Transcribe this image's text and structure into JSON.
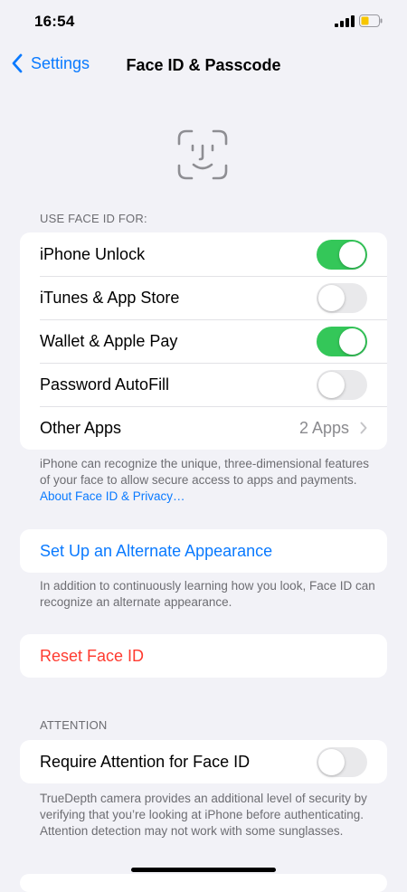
{
  "status_bar": {
    "time": "16:54",
    "battery_color": "#f7c600"
  },
  "nav": {
    "back_label": "Settings",
    "title": "Face ID & Passcode"
  },
  "icons": {
    "face_id": "face-id-icon",
    "back": "chevron-left-icon",
    "disclosure": "chevron-right-icon",
    "signal": "cellular-signal-icon",
    "battery": "battery-icon"
  },
  "use_face_id": {
    "header": "USE FACE ID FOR:",
    "rows": [
      {
        "label": "iPhone Unlock",
        "on": true
      },
      {
        "label": "iTunes & App Store",
        "on": false
      },
      {
        "label": "Wallet & Apple Pay",
        "on": true
      },
      {
        "label": "Password AutoFill",
        "on": false
      },
      {
        "label": "Other Apps",
        "value": "2 Apps"
      }
    ],
    "footer_text": "iPhone can recognize the unique, three-dimensional features of your face to allow secure access to apps and payments. ",
    "footer_link": "About Face ID & Privacy…"
  },
  "alternate": {
    "button_label": "Set Up an Alternate Appearance",
    "footer": "In addition to continuously learning how you look, Face ID can recognize an alternate appearance."
  },
  "reset": {
    "button_label": "Reset Face ID"
  },
  "attention": {
    "header": "ATTENTION",
    "row_label": "Require Attention for Face ID",
    "on": false,
    "footer": "TrueDepth camera provides an additional level of security by verifying that you’re looking at iPhone before authenticating. Attention detection may not work with some sunglasses."
  },
  "colors": {
    "accent": "#0a7aff",
    "toggle_on": "#34c759",
    "destructive": "#ff3b30",
    "background": "#f2f2f7"
  }
}
